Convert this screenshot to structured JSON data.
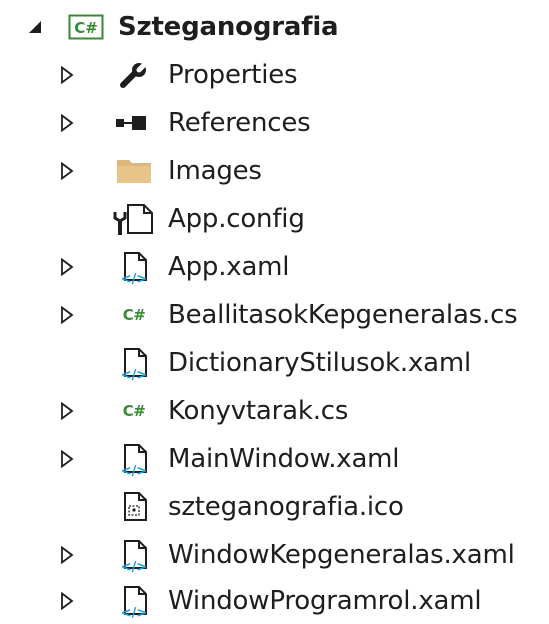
{
  "colors": {
    "text": "#1e1e1e",
    "arrow": "#1e1e1e",
    "csharp_green": "#388a34",
    "folder_tan": "#dcb67a",
    "xaml_blue": "#1ba1e2"
  },
  "tree": {
    "root": {
      "label": "Szteganografia",
      "icon": "csharp-project-icon",
      "expanded": true
    },
    "items": [
      {
        "label": "Properties",
        "icon": "wrench-icon",
        "has_children": true
      },
      {
        "label": "References",
        "icon": "references-icon",
        "has_children": true
      },
      {
        "label": "Images",
        "icon": "folder-icon",
        "has_children": true
      },
      {
        "label": "App.config",
        "icon": "config-file-icon",
        "has_children": false
      },
      {
        "label": "App.xaml",
        "icon": "xaml-file-icon",
        "has_children": true
      },
      {
        "label": "BeallitasokKepgeneralas.cs",
        "icon": "csharp-file-icon",
        "has_children": true,
        "icon_text": "C#"
      },
      {
        "label": "DictionaryStilusok.xaml",
        "icon": "xaml-file-icon",
        "has_children": false
      },
      {
        "label": "Konyvtarak.cs",
        "icon": "csharp-file-icon",
        "has_children": true,
        "icon_text": "C#"
      },
      {
        "label": "MainWindow.xaml",
        "icon": "xaml-file-icon",
        "has_children": true
      },
      {
        "label": "szteganografia.ico",
        "icon": "ico-file-icon",
        "has_children": false
      },
      {
        "label": "WindowKepgeneralas.xaml",
        "icon": "xaml-file-icon",
        "has_children": true
      },
      {
        "label": "WindowProgramrol.xaml",
        "icon": "xaml-file-icon",
        "has_children": true
      }
    ]
  }
}
